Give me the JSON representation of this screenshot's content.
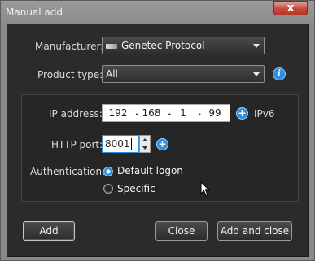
{
  "window": {
    "title": "Manual add",
    "close_glyph": "x"
  },
  "form": {
    "manufacturer_label": "Manufacturer:",
    "manufacturer_value": "Genetec Protocol",
    "manufacturer_icon": "genetec-logo-icon",
    "product_type_label": "Product type:",
    "product_type_value": "All",
    "info_glyph": "i",
    "ip_label": "IP address:",
    "ip_octets": [
      "192",
      "168",
      "1",
      "99"
    ],
    "ip_separator": ".",
    "ipv6_label": "IPv6",
    "plus_glyph": "+",
    "http_port_label": "HTTP port:",
    "http_port_value": "8001",
    "auth_label": "Authentication:",
    "auth_options": [
      {
        "label": "Default logon",
        "selected": true
      },
      {
        "label": "Specific",
        "selected": false
      }
    ]
  },
  "buttons": {
    "add": "Add",
    "close": "Close",
    "add_and_close": "Add and close"
  },
  "colors": {
    "accent": "#2d8fe0",
    "close_button": "#c54a3b",
    "background": "#2b2b2b"
  }
}
